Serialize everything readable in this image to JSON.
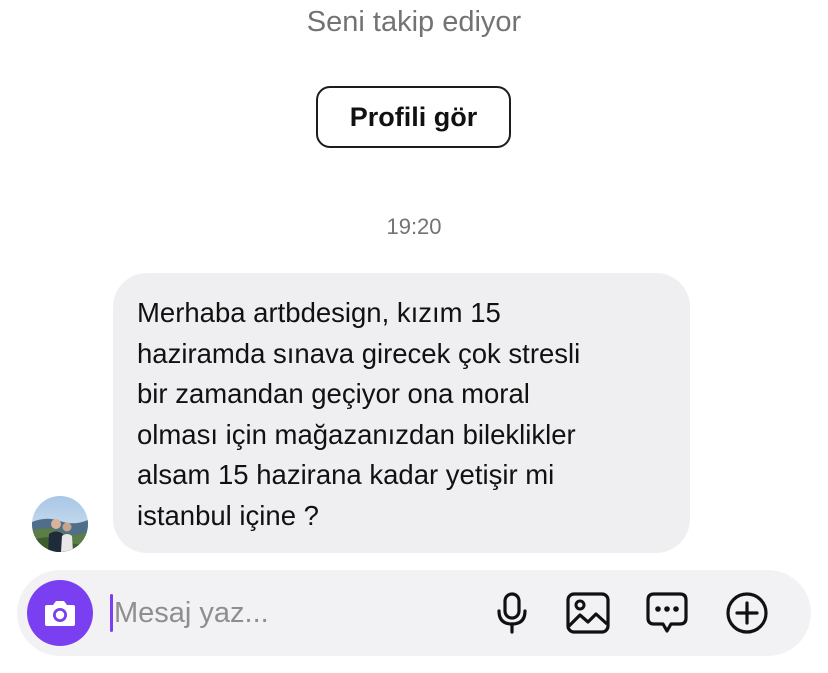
{
  "header": {
    "follow_text": "Seni takip ediyor",
    "profile_button_label": "Profili gör"
  },
  "thread": {
    "timestamp": "19:20",
    "messages": [
      {
        "sender": "other",
        "text": "Merhaba artbdesign, kızım 15\nhaziramda sınava girecek çok stresli\nbir zamandan geçiyor ona moral\nolması için mağazanızdan bileklikler\nalsam 15 hazirana kadar yetişir mi\nistanbul içine ?"
      }
    ]
  },
  "composer": {
    "placeholder": "Mesaj yaz...",
    "value": "",
    "icons": {
      "camera": "camera-icon",
      "microphone": "microphone-icon",
      "gallery": "image-icon",
      "stickers": "message-more-icon",
      "add": "plus-circle-icon"
    }
  },
  "colors": {
    "accent": "#7b3ff2",
    "bubble_background": "#efeff1",
    "composer_background": "#f2f2f4",
    "secondary_text": "#737373"
  }
}
